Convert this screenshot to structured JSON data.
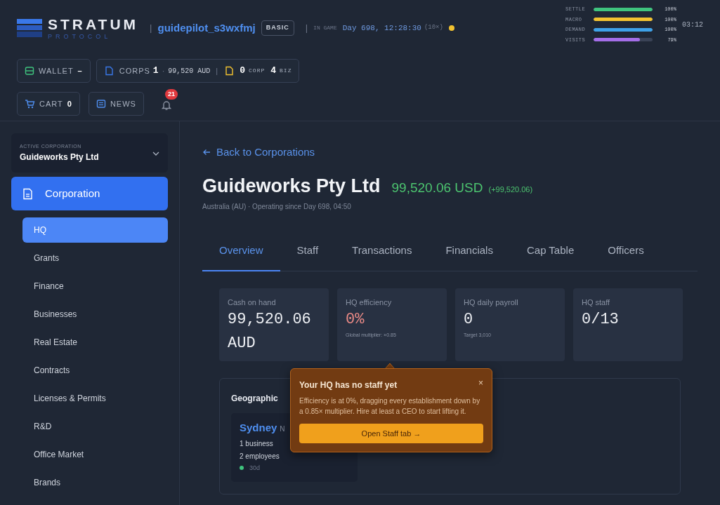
{
  "header": {
    "logo": {
      "name": "STRATUM",
      "tagline": "PROTOCOL"
    },
    "username": "guidepilot_s3wxfmj",
    "plan": "BASIC",
    "separator": "|",
    "game_label": "IN GAME",
    "game_time": "Day 698, 12:28:30",
    "speed": "(10×)",
    "live": true,
    "meters": [
      {
        "label": "SETTLE",
        "level": 1,
        "reading": "100%",
        "color": "#3fc47e"
      },
      {
        "label": "MACRO",
        "level": 1,
        "reading": "100%",
        "color": "#f2c230"
      },
      {
        "label": "DEMAND",
        "level": 1,
        "reading": "100%",
        "color": "#3ea2e8"
      },
      {
        "label": "VISITS",
        "level": 0.79,
        "reading": "79%",
        "color": "#a46ee8"
      }
    ],
    "clock": "03:12",
    "wallet": {
      "label": "WALLET",
      "value": "–"
    },
    "corps": {
      "label": "CORPS",
      "count": "1",
      "sep": "·",
      "amount": "99,520 AUD",
      "corp_count": "0",
      "corp_label": "CORP",
      "biz_count": "4",
      "biz_label": "BIZ"
    },
    "cart": {
      "label": "CART",
      "count": "0"
    },
    "news": {
      "label": "NEWS"
    },
    "notifications": "21"
  },
  "sidebar": {
    "selector": {
      "label": "ACTIVE CORPORATION",
      "value": "Guideworks Pty Ltd"
    },
    "section": {
      "label": "Corporation",
      "selected": true
    },
    "items": [
      {
        "label": "HQ",
        "selected": true
      },
      {
        "label": "Grants",
        "selected": false
      },
      {
        "label": "Finance",
        "selected": false
      },
      {
        "label": "Businesses",
        "selected": false
      },
      {
        "label": "Real Estate",
        "selected": false
      },
      {
        "label": "Contracts",
        "selected": false
      },
      {
        "label": "Licenses & Permits",
        "selected": false
      },
      {
        "label": "R&D",
        "selected": false
      },
      {
        "label": "Office Market",
        "selected": false
      },
      {
        "label": "Brands",
        "selected": false
      }
    ]
  },
  "main": {
    "back": "Back to Corporations",
    "title": "Guideworks Pty Ltd",
    "balance": "99,520.06 USD",
    "delta": "(+99,520.06)",
    "subtitle": "Australia (AU) · Operating since Day 698, 04:50",
    "tabs": [
      {
        "label": "Overview",
        "selected": true
      },
      {
        "label": "Staff",
        "selected": false
      },
      {
        "label": "Transactions",
        "selected": false
      },
      {
        "label": "Financials",
        "selected": false
      },
      {
        "label": "Cap Table",
        "selected": false
      },
      {
        "label": "Officers",
        "selected": false
      }
    ],
    "stats": [
      {
        "label": "Cash on hand",
        "value": "99,520.06 AUD",
        "kind": "normal"
      },
      {
        "label": "HQ efficiency",
        "value": "0%",
        "kind": "alert",
        "note": "Global multiplier: ×0.85"
      },
      {
        "label": "HQ daily payroll",
        "value": "0",
        "kind": "normal",
        "note": "Target 3,010"
      },
      {
        "label": "HQ staff",
        "value": "0/13",
        "kind": "normal"
      }
    ],
    "geo": {
      "title": "Geographic",
      "city": {
        "name": "Sydney",
        "tag": "N",
        "lines": [
          "1 business",
          "2 employees"
        ],
        "age": "30d",
        "color": "#3fc47e"
      }
    },
    "popover": {
      "title": "Your HQ has no staff yet",
      "close": "×",
      "text": "Efficiency is at 0%, dragging every establishment down by a 0.85× multiplier. Hire at least a CEO to start lifting it.",
      "action": "Open Staff tab →"
    }
  }
}
